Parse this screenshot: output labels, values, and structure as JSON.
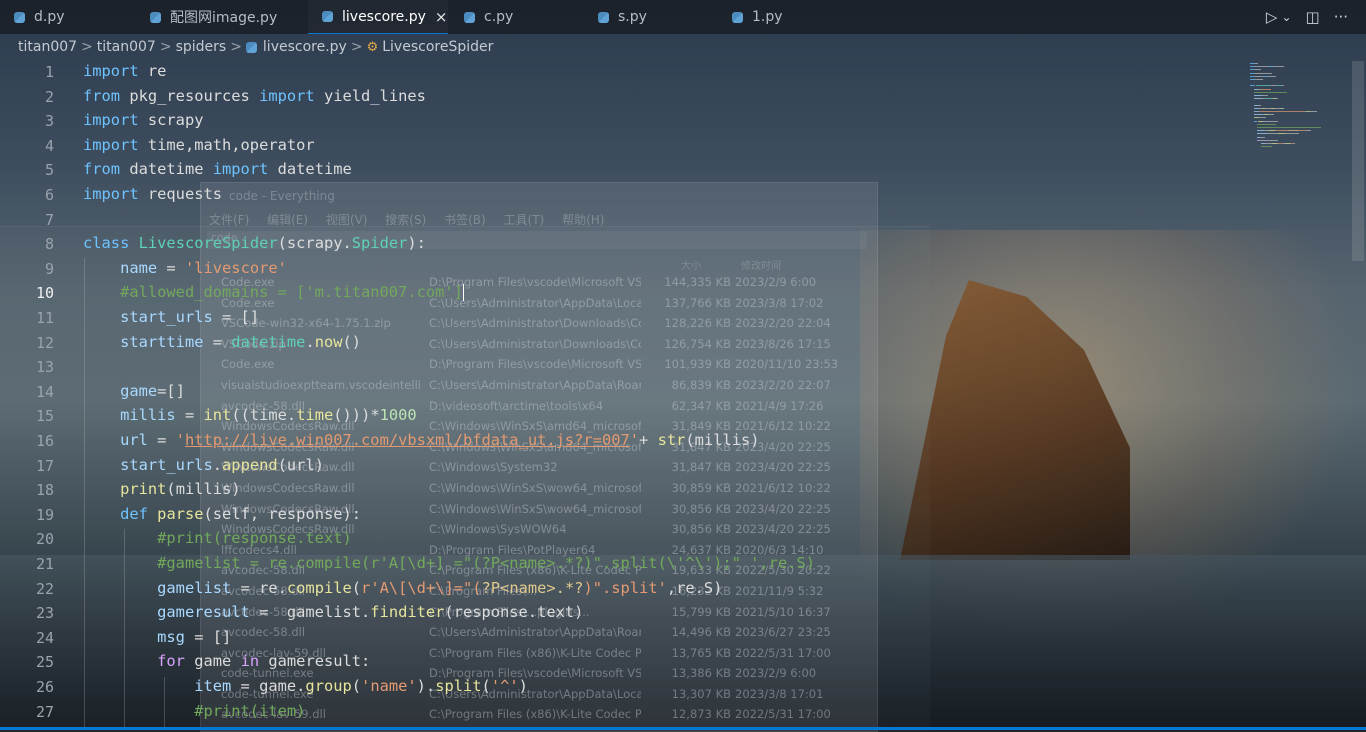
{
  "tabs": [
    {
      "label": "d.py",
      "active": false
    },
    {
      "label": "配图网image.py",
      "active": false
    },
    {
      "label": "livescore.py",
      "active": true
    },
    {
      "label": "c.py",
      "active": false
    },
    {
      "label": "s.py",
      "active": false
    },
    {
      "label": "1.py",
      "active": false
    }
  ],
  "tab_close_glyph": "×",
  "breadcrumb": {
    "parts": [
      "titan007",
      "titan007",
      "spiders",
      "livescore.py",
      "LivescoreSpider"
    ],
    "separator": ">"
  },
  "actions": {
    "run_glyph": "▷",
    "dropdown_glyph": "⌄",
    "split_glyph": "◫",
    "more_glyph": "···"
  },
  "editor": {
    "current_line": 10,
    "lines": [
      {
        "n": "1"
      },
      {
        "n": "2"
      },
      {
        "n": "3"
      },
      {
        "n": "4"
      },
      {
        "n": "5"
      },
      {
        "n": "6"
      },
      {
        "n": "7"
      },
      {
        "n": "8"
      },
      {
        "n": "9"
      },
      {
        "n": "10"
      },
      {
        "n": "11"
      },
      {
        "n": "12"
      },
      {
        "n": "13"
      },
      {
        "n": "14"
      },
      {
        "n": "15"
      },
      {
        "n": "16"
      },
      {
        "n": "17"
      },
      {
        "n": "18"
      },
      {
        "n": "19"
      },
      {
        "n": "20"
      },
      {
        "n": "21"
      },
      {
        "n": "22"
      },
      {
        "n": "23"
      },
      {
        "n": "24"
      },
      {
        "n": "25"
      },
      {
        "n": "26"
      },
      {
        "n": "27"
      }
    ],
    "code": [
      [
        [
          "kw",
          "import"
        ],
        [
          "t",
          " re"
        ]
      ],
      [
        [
          "kw",
          "from"
        ],
        [
          "t",
          " pkg_resources "
        ],
        [
          "kw",
          "import"
        ],
        [
          "t",
          " yield_lines"
        ]
      ],
      [
        [
          "kw",
          "import"
        ],
        [
          "t",
          " scrapy"
        ]
      ],
      [
        [
          "kw",
          "import"
        ],
        [
          "t",
          " time,math,operator"
        ]
      ],
      [
        [
          "kw",
          "from"
        ],
        [
          "t",
          " datetime "
        ],
        [
          "kw",
          "import"
        ],
        [
          "t",
          " datetime"
        ]
      ],
      [
        [
          "kw",
          "import"
        ],
        [
          "t",
          " requests"
        ]
      ],
      [],
      [
        [
          "kw",
          "class"
        ],
        [
          "t",
          " "
        ],
        [
          "cls",
          "LivescoreSpider"
        ],
        [
          "t",
          "(scrapy."
        ],
        [
          "cls",
          "Spider"
        ],
        [
          "t",
          "):"
        ]
      ],
      [
        [
          "t",
          "    "
        ],
        [
          "var",
          "name"
        ],
        [
          "t",
          " = "
        ],
        [
          "str",
          "'livescore'"
        ]
      ],
      [
        [
          "t",
          "    "
        ],
        [
          "cm",
          "#allowed_domains = ['m.titan007.com']"
        ],
        [
          "cursor",
          ""
        ]
      ],
      [
        [
          "t",
          "    "
        ],
        [
          "var",
          "start_urls"
        ],
        [
          "t",
          " = []"
        ]
      ],
      [
        [
          "t",
          "    "
        ],
        [
          "var",
          "starttime"
        ],
        [
          "t",
          " = "
        ],
        [
          "cls",
          "datetime"
        ],
        [
          "t",
          "."
        ],
        [
          "fn",
          "now"
        ],
        [
          "t",
          "()"
        ]
      ],
      [],
      [
        [
          "t",
          "    "
        ],
        [
          "var",
          "game"
        ],
        [
          "t",
          "=[]"
        ]
      ],
      [
        [
          "t",
          "    "
        ],
        [
          "var",
          "millis"
        ],
        [
          "t",
          " = "
        ],
        [
          "fn",
          "int"
        ],
        [
          "t",
          "((time."
        ],
        [
          "fn",
          "time"
        ],
        [
          "t",
          "()))*"
        ],
        [
          "num",
          "1000"
        ]
      ],
      [
        [
          "t",
          "    "
        ],
        [
          "var",
          "url"
        ],
        [
          "t",
          " = "
        ],
        [
          "str",
          "'"
        ],
        [
          "url",
          "http://live.win007.com/vbsxml/bfdata_ut.js?r=007"
        ],
        [
          "str",
          "'"
        ],
        [
          "t",
          "+ "
        ],
        [
          "fn",
          "str"
        ],
        [
          "t",
          "(millis)"
        ]
      ],
      [
        [
          "t",
          "    "
        ],
        [
          "var",
          "start_urls"
        ],
        [
          "t",
          "."
        ],
        [
          "fn",
          "append"
        ],
        [
          "t",
          "(url)"
        ]
      ],
      [
        [
          "t",
          "    "
        ],
        [
          "fn",
          "print"
        ],
        [
          "t",
          "(millis)"
        ]
      ],
      [
        [
          "t",
          "    "
        ],
        [
          "kw",
          "def"
        ],
        [
          "t",
          " "
        ],
        [
          "fn",
          "parse"
        ],
        [
          "t",
          "(self, response):"
        ]
      ],
      [
        [
          "t",
          "        "
        ],
        [
          "cm",
          "#print(response.text)"
        ]
      ],
      [
        [
          "t",
          "        "
        ],
        [
          "cm",
          "#gamelist = re.compile(r'A[\\d+] =\"(?P<name>.*?)\".split(\\'^\\');\" ',re.S)"
        ]
      ],
      [
        [
          "t",
          "        "
        ],
        [
          "var",
          "gamelist"
        ],
        [
          "t",
          " = re."
        ],
        [
          "fn",
          "compile"
        ],
        [
          "t",
          "("
        ],
        [
          "str",
          "r'A\\[\\d+\\]=\"("
        ],
        [
          "rx",
          "?P<name>.*?"
        ],
        [
          "str",
          ")\".split'"
        ],
        [
          "t",
          ",re.S)"
        ]
      ],
      [
        [
          "t",
          "        "
        ],
        [
          "var",
          "gameresult"
        ],
        [
          "t",
          " =  gamelist."
        ],
        [
          "fn",
          "finditer"
        ],
        [
          "t",
          "(response.text)"
        ]
      ],
      [
        [
          "t",
          "        "
        ],
        [
          "var",
          "msg"
        ],
        [
          "t",
          " = []"
        ]
      ],
      [
        [
          "t",
          "        "
        ],
        [
          "kw2",
          "for"
        ],
        [
          "t",
          " game "
        ],
        [
          "kw2",
          "in"
        ],
        [
          "t",
          " gameresult:"
        ]
      ],
      [
        [
          "t",
          "            "
        ],
        [
          "var",
          "item"
        ],
        [
          "t",
          " = game."
        ],
        [
          "fn",
          "group"
        ],
        [
          "t",
          "("
        ],
        [
          "str",
          "'name'"
        ],
        [
          "t",
          ")."
        ],
        [
          "fn",
          "split"
        ],
        [
          "t",
          "("
        ],
        [
          "str",
          "'^'"
        ],
        [
          "t",
          ")"
        ]
      ],
      [
        [
          "t",
          "            "
        ],
        [
          "cm",
          "#print(item)"
        ]
      ]
    ]
  },
  "background_window": {
    "title": "code - Everything",
    "menu": [
      "文件(F)",
      "编辑(E)",
      "视图(V)",
      "搜索(S)",
      "书签(B)",
      "工具(T)",
      "帮助(H)"
    ],
    "search": "code",
    "headers": [
      "大小",
      "修改时间"
    ],
    "rows": [
      [
        "Code.exe",
        "D:\\Program Files\\vscode\\Microsoft VS ...",
        "144,335 KB",
        "2023/2/9 6:00"
      ],
      [
        "Code.exe",
        "C:\\Users\\Administrator\\AppData\\Local...",
        "137,766 KB",
        "2023/3/8 17:02"
      ],
      [
        "VSCode-win32-x64-1.75.1.zip",
        "C:\\Users\\Administrator\\Downloads\\Co...",
        "128,226 KB",
        "2023/2/20 22:04"
      ],
      [
        "VSCode.zip",
        "C:\\Users\\Administrator\\Downloads\\Co...",
        "126,754 KB",
        "2023/8/26 17:15"
      ],
      [
        "Code.exe",
        "D:\\Program Files\\vscode\\Microsoft VS ...",
        "101,939 KB",
        "2020/11/10 23:53"
      ],
      [
        "visualstudioexptteam.vscodeintellico...",
        "C:\\Users\\Administrator\\AppData\\Roam...",
        "86,839 KB",
        "2023/2/20 22:07"
      ],
      [
        "avcodec-58.dll",
        "D:\\videosoft\\arctime\\tools\\x64",
        "62,347 KB",
        "2021/4/9 17:26"
      ],
      [
        "WindowsCodecsRaw.dll",
        "C:\\Windows\\WinSxS\\amd64_microsoft-...",
        "31,849 KB",
        "2021/6/12 10:22"
      ],
      [
        "WindowsCodecsRaw.dll",
        "C:\\Windows\\WinSxS\\amd64_microsoft-...",
        "31,847 KB",
        "2023/4/20 22:25"
      ],
      [
        "WindowsCodecsRaw.dll",
        "C:\\Windows\\System32",
        "31,847 KB",
        "2023/4/20 22:25"
      ],
      [
        "WindowsCodecsRaw.dll",
        "C:\\Windows\\WinSxS\\wow64_microsoft...",
        "30,859 KB",
        "2021/6/12 10:22"
      ],
      [
        "WindowsCodecsRaw.dll",
        "C:\\Windows\\WinSxS\\wow64_microsoft...",
        "30,856 KB",
        "2023/4/20 22:25"
      ],
      [
        "WindowsCodecsRaw.dll",
        "C:\\Windows\\SysWOW64",
        "30,856 KB",
        "2023/4/20 22:25"
      ],
      [
        "lffcodecs4.dll",
        "D:\\Program Files\\PotPlayer64",
        "24,637 KB",
        "2020/6/3 14:10"
      ],
      [
        "avcodec-58.dll",
        "C:\\Program Files (x86)\\K-Lite Codec P...",
        "19,633 KB",
        "2022/5/30 20:22"
      ],
      [
        "avcodec-58.dll",
        "C:\\Program Files\\...",
        "16,232 KB",
        "2021/11/9 5:32"
      ],
      [
        "avcodec-58.dll",
        "C:\\Program Files\\...plugins...",
        "15,799 KB",
        "2021/5/10 16:37"
      ],
      [
        "avcodec-58.dll",
        "C:\\Users\\Administrator\\AppData\\Roam...",
        "14,496 KB",
        "2023/6/27 23:25"
      ],
      [
        "avcodec-lav-59.dll",
        "C:\\Program Files (x86)\\K-Lite Codec P...",
        "13,765 KB",
        "2022/5/31 17:00"
      ],
      [
        "code-tunnel.exe",
        "D:\\Program Files\\vscode\\Microsoft VS ...",
        "13,386 KB",
        "2023/2/9 6:00"
      ],
      [
        "code-tunnel.exe",
        "C:\\Users\\Administrator\\AppData\\Local...",
        "13,307 KB",
        "2023/3/8 17:01"
      ],
      [
        "avcodec-lav-59.dll",
        "C:\\Program Files (x86)\\K-Lite Codec P...",
        "12,873 KB",
        "2022/5/31 17:00"
      ]
    ]
  },
  "colors": {
    "accent": "#0078d4",
    "keyword": "#6ec3ff",
    "string": "#e39a72",
    "comment": "#72a85c"
  }
}
